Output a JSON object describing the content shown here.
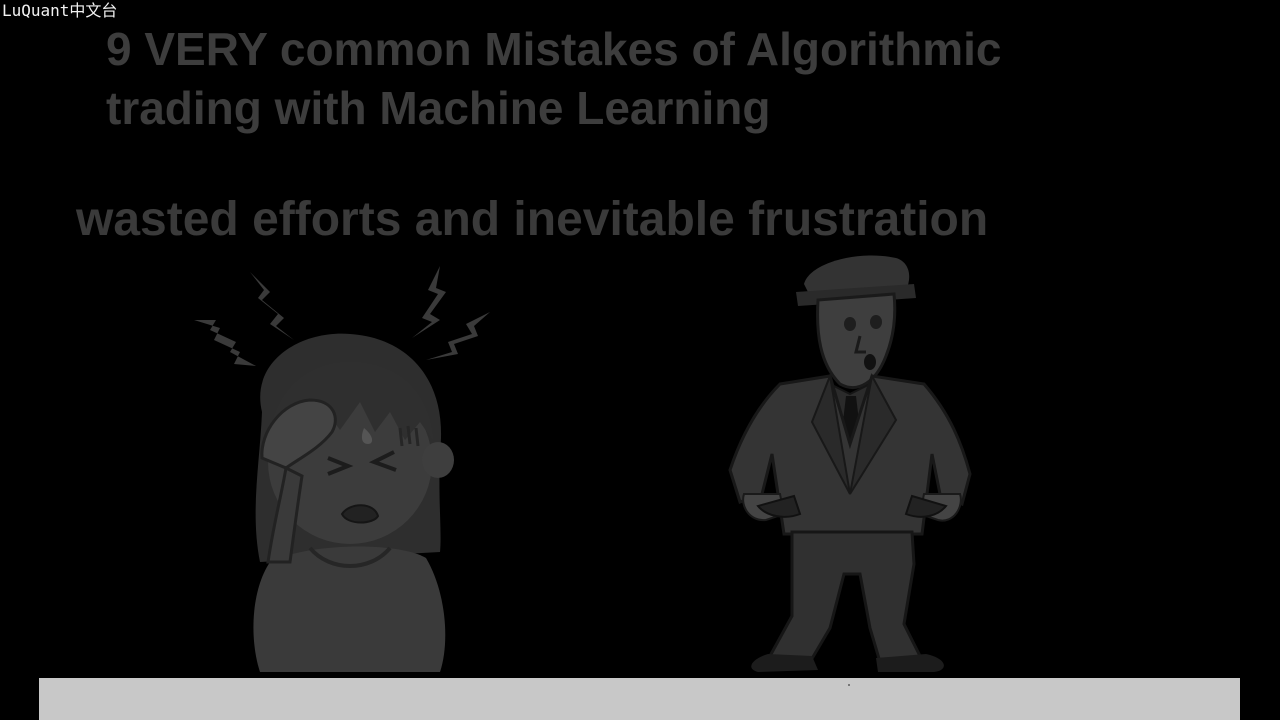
{
  "watermark": "LuQuant中文台",
  "title": {
    "line1": "9 VERY common Mistakes of Algorithmic",
    "line2": "trading with Machine Learning"
  },
  "subtitle": "wasted efforts and inevitable frustration",
  "illustrations": {
    "left": "frustrated-girl-icon",
    "right": "broke-man-empty-pockets-icon"
  },
  "colors": {
    "background": "#000000",
    "title_text": "#3d3d3d",
    "caption_bar": "#c8c8c8"
  }
}
